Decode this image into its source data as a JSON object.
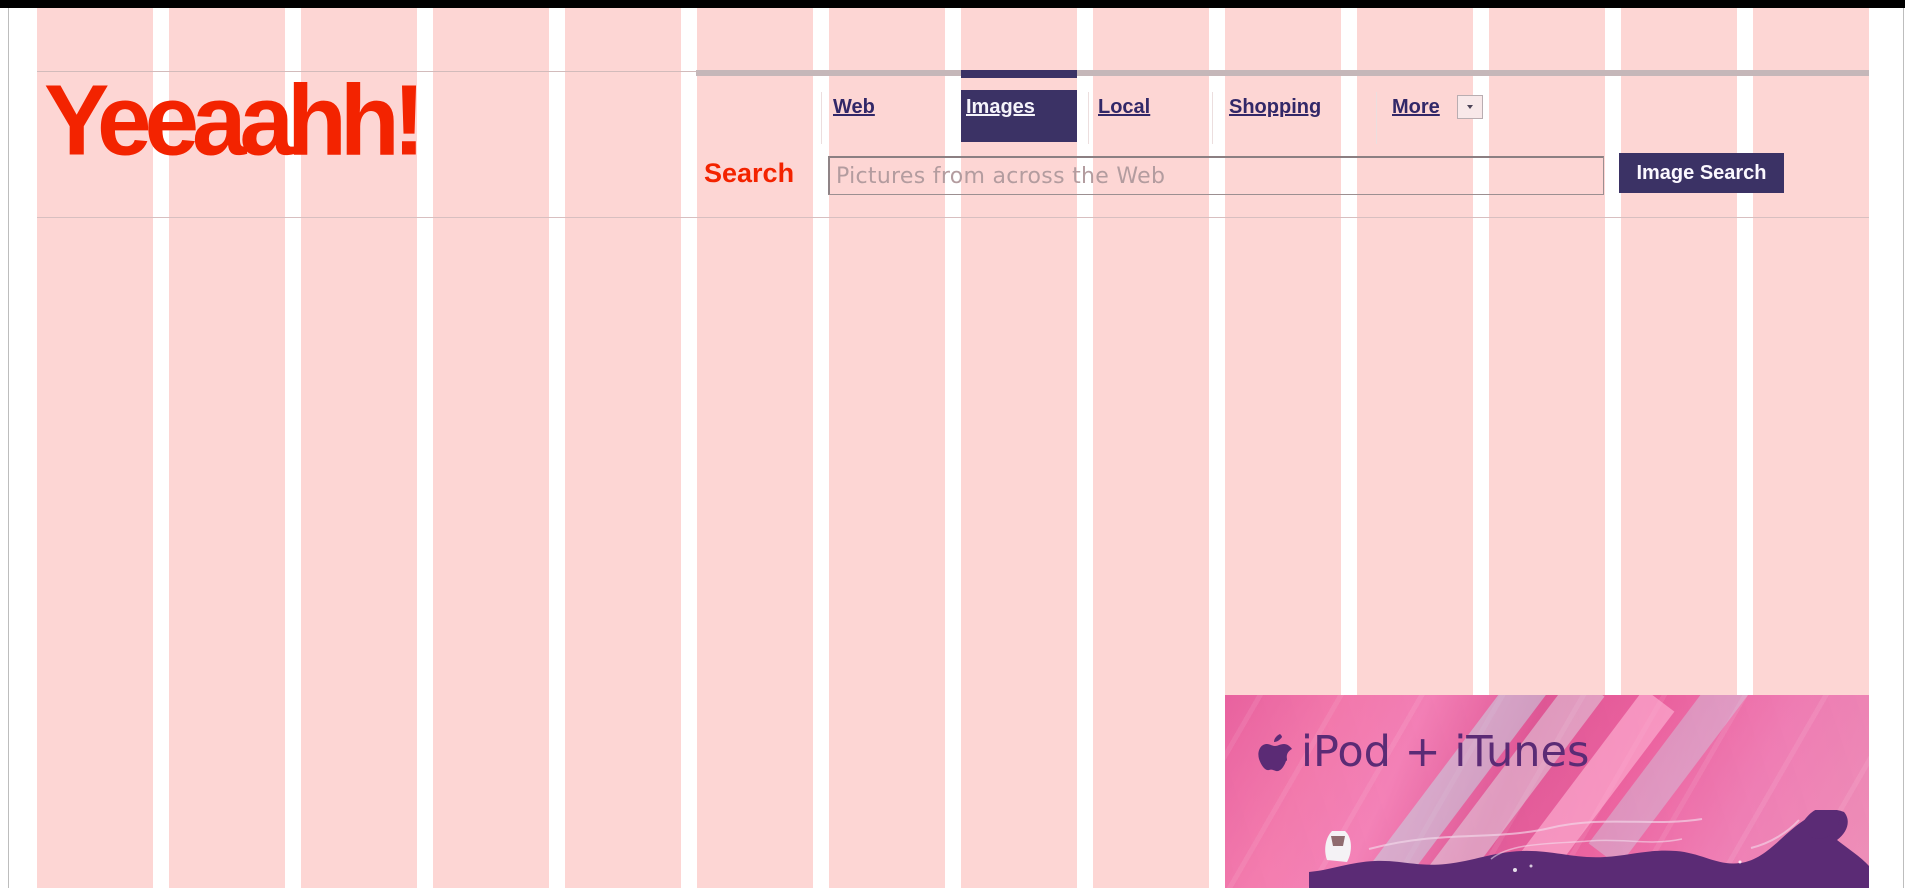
{
  "brand": {
    "logo_text": "Yeeaahh!",
    "logo_color": "#f32300"
  },
  "navigation": {
    "tabs": [
      {
        "label": "Web",
        "active": false
      },
      {
        "label": "Images",
        "active": true
      },
      {
        "label": "Local",
        "active": false
      },
      {
        "label": "Shopping",
        "active": false
      },
      {
        "label": "More",
        "active": false
      }
    ],
    "more_icon": "chevron-down-icon",
    "active_tab_color": "#3b3265"
  },
  "search": {
    "label": "Search",
    "placeholder": "Pictures from across the Web",
    "button_label": "Image Search",
    "button_color": "#3b3265"
  },
  "background": {
    "grid_color": "#fdd6d4",
    "gutter_color": "#ffffff"
  },
  "advertisement": {
    "title": "iPod + iTunes",
    "logo_icon": "apple-icon",
    "accent_color": "#5b2b75"
  }
}
